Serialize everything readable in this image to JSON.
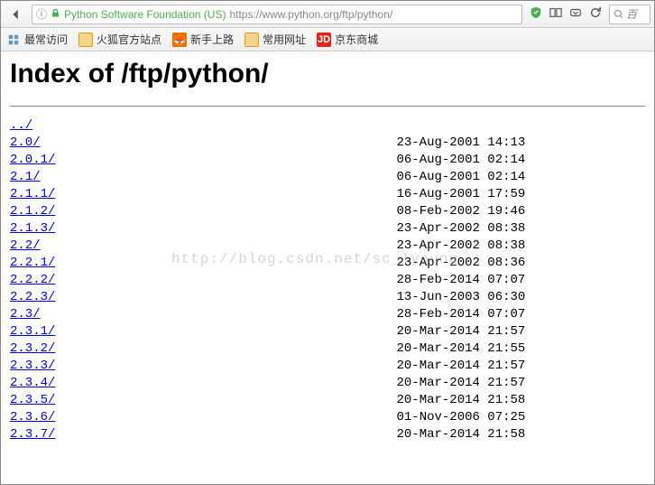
{
  "nav": {
    "org": "Python Software Foundation (US)",
    "url": "https://www.python.org/ftp/python/",
    "search_placeholder": "百",
    "search_icon_label": "search"
  },
  "bookmarks": {
    "b0": "最常访问",
    "b1": "火狐官方站点",
    "b2": "新手上路",
    "b3": "常用网址",
    "b4_ic": "JD",
    "b4": "京东商城"
  },
  "page": {
    "title": "Index of /ftp/python/",
    "parent": "../",
    "watermark": "http://blog.csdn.net/sc_lyoung"
  },
  "rows": [
    {
      "name": "2.0/",
      "date": "23-Aug-2001 14:13",
      "size": "-"
    },
    {
      "name": "2.0.1/",
      "date": "06-Aug-2001 02:14",
      "size": "-"
    },
    {
      "name": "2.1/",
      "date": "06-Aug-2001 02:14",
      "size": "-"
    },
    {
      "name": "2.1.1/",
      "date": "16-Aug-2001 17:59",
      "size": "-"
    },
    {
      "name": "2.1.2/",
      "date": "08-Feb-2002 19:46",
      "size": "-"
    },
    {
      "name": "2.1.3/",
      "date": "23-Apr-2002 08:38",
      "size": "-"
    },
    {
      "name": "2.2/",
      "date": "23-Apr-2002 08:38",
      "size": "-"
    },
    {
      "name": "2.2.1/",
      "date": "23-Apr-2002 08:36",
      "size": "-"
    },
    {
      "name": "2.2.2/",
      "date": "28-Feb-2014 07:07",
      "size": "-"
    },
    {
      "name": "2.2.3/",
      "date": "13-Jun-2003 06:30",
      "size": "-"
    },
    {
      "name": "2.3/",
      "date": "28-Feb-2014 07:07",
      "size": "-"
    },
    {
      "name": "2.3.1/",
      "date": "20-Mar-2014 21:57",
      "size": "-"
    },
    {
      "name": "2.3.2/",
      "date": "20-Mar-2014 21:55",
      "size": "-"
    },
    {
      "name": "2.3.3/",
      "date": "20-Mar-2014 21:57",
      "size": "-"
    },
    {
      "name": "2.3.4/",
      "date": "20-Mar-2014 21:57",
      "size": "-"
    },
    {
      "name": "2.3.5/",
      "date": "20-Mar-2014 21:58",
      "size": "-"
    },
    {
      "name": "2.3.6/",
      "date": "01-Nov-2006 07:25",
      "size": "-"
    },
    {
      "name": "2.3.7/",
      "date": "20-Mar-2014 21:58",
      "size": "-"
    }
  ]
}
